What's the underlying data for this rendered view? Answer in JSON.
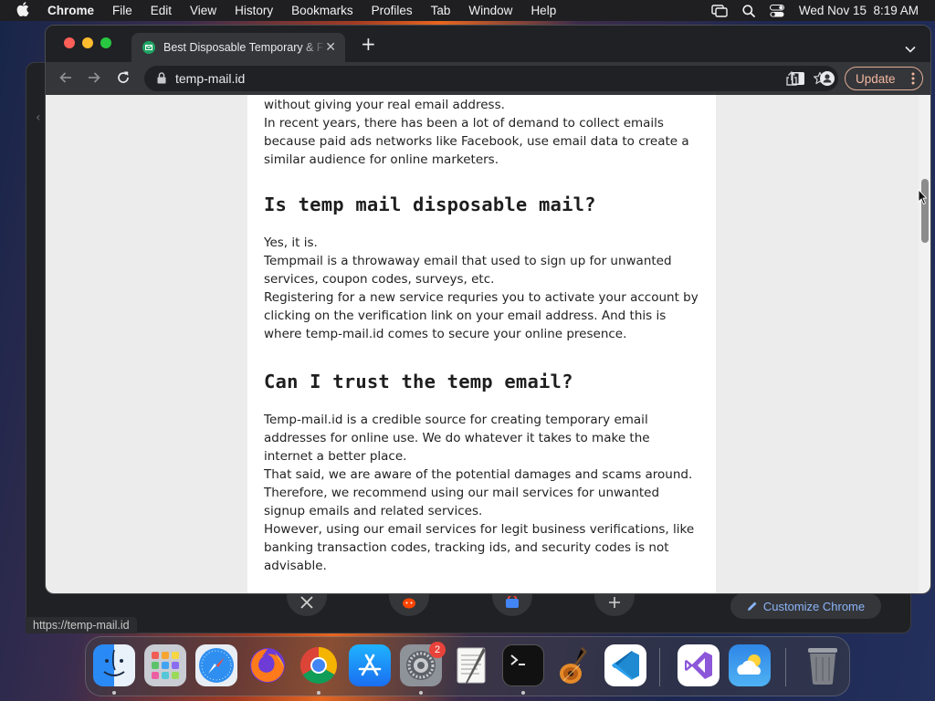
{
  "menubar": {
    "app": "Chrome",
    "items": [
      "File",
      "Edit",
      "View",
      "History",
      "Bookmarks",
      "Profiles",
      "Tab",
      "Window",
      "Help"
    ],
    "datetime": "Wed Nov 15  8:19 AM"
  },
  "tab": {
    "title": "Best Disposable Temporary & F"
  },
  "omnibox": {
    "url": "temp-mail.id"
  },
  "toolbar": {
    "update_label": "Update"
  },
  "article": {
    "top_lines": [
      "without giving your real email address.",
      "In recent years, there has been a lot of demand to collect emails because paid ads networks like Facebook, use email data to create a similar audience for online marketers."
    ],
    "sections": [
      {
        "heading": "Is temp mail disposable mail?",
        "paragraphs": [
          "Yes, it is.",
          "Tempmail is a throwaway email that used to sign up for unwanted services, coupon codes, surveys, etc.",
          "Registering for a new service requries you to activate your account by clicking on the verification link on your email address. And this is where temp-mail.id comes to secure your online presence."
        ]
      },
      {
        "heading": "Can I trust the temp email?",
        "paragraphs": [
          "Temp-mail.id is a credible source for creating temporary email addresses for online use. We do whatever it takes to make the internet a better place.",
          "That said, we are aware of the potential damages and scams around. Therefore, we recommend using our mail services for unwanted signup emails and related services.",
          "However, using our email services for legit business verifications, like banking transaction codes, tracking ids, and security codes is not advisable."
        ]
      }
    ]
  },
  "background_window": {
    "customize_label": "Customize Chrome",
    "status_url": "https://temp-mail.id"
  },
  "dock": {
    "settings_badge": "2",
    "apps": [
      "finder-icon",
      "launchpad-icon",
      "safari-icon",
      "firefox-icon",
      "chrome-icon",
      "app-store-icon",
      "system-settings-icon",
      "textedit-icon",
      "terminal-icon",
      "garageband-icon",
      "vscode-icon",
      "visual-studio-icon",
      "weather-icon",
      "trash-icon"
    ]
  }
}
